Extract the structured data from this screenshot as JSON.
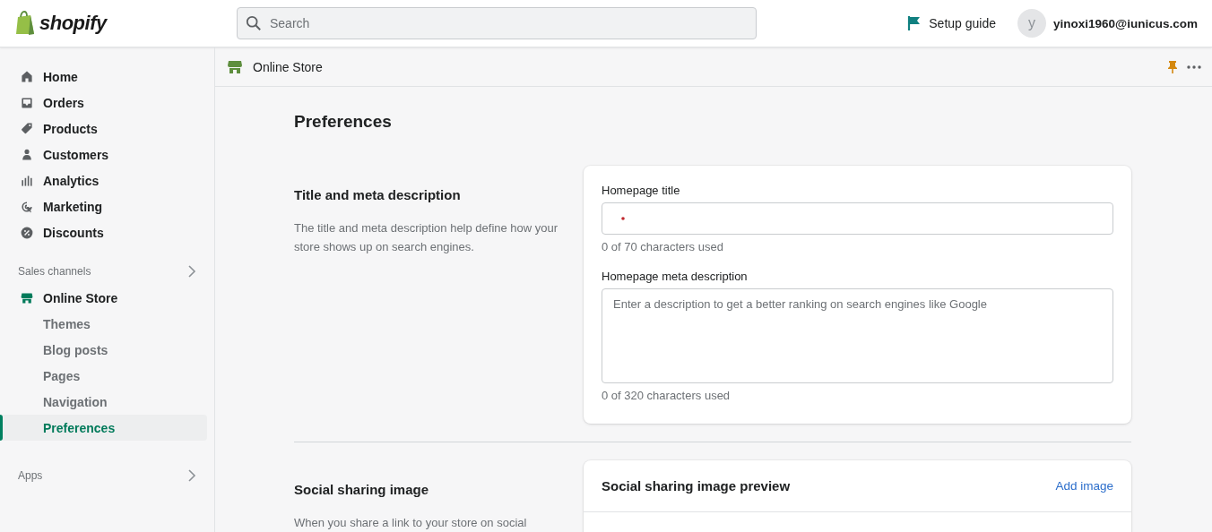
{
  "topbar": {
    "logo": "shopify",
    "search": {
      "placeholder": "Search"
    },
    "setup_guide": "Setup guide",
    "avatar_initial": "y",
    "account": "yinoxi1960@iunicus.com"
  },
  "sidebar": {
    "items": [
      {
        "label": "Home"
      },
      {
        "label": "Orders"
      },
      {
        "label": "Products"
      },
      {
        "label": "Customers"
      },
      {
        "label": "Analytics"
      },
      {
        "label": "Marketing"
      },
      {
        "label": "Discounts"
      }
    ],
    "sales_channels": {
      "label": "Sales channels",
      "channel": "Online Store",
      "children": [
        {
          "label": "Themes",
          "selected": false
        },
        {
          "label": "Blog posts",
          "selected": false
        },
        {
          "label": "Pages",
          "selected": false
        },
        {
          "label": "Navigation",
          "selected": false
        },
        {
          "label": "Preferences",
          "selected": true
        }
      ]
    },
    "apps": {
      "label": "Apps"
    }
  },
  "header": {
    "title": "Online Store"
  },
  "page": {
    "title": "Preferences",
    "sections": [
      {
        "title": "Title and meta description",
        "description": "The title and meta description help define how your store shows up on search engines.",
        "card": {
          "fields": [
            {
              "kind": "input",
              "label": "Homepage title",
              "help": "0 of 70 characters used"
            },
            {
              "kind": "textarea",
              "label": "Homepage meta description",
              "placeholder": "Enter a description to get a better ranking on search engines like Google",
              "help": "0 of 320 characters used"
            }
          ]
        }
      },
      {
        "title": "Social sharing image",
        "description": "When you share a link to your store on social",
        "card": {
          "heading": "Social sharing image preview",
          "action": "Add image"
        }
      }
    ]
  }
}
